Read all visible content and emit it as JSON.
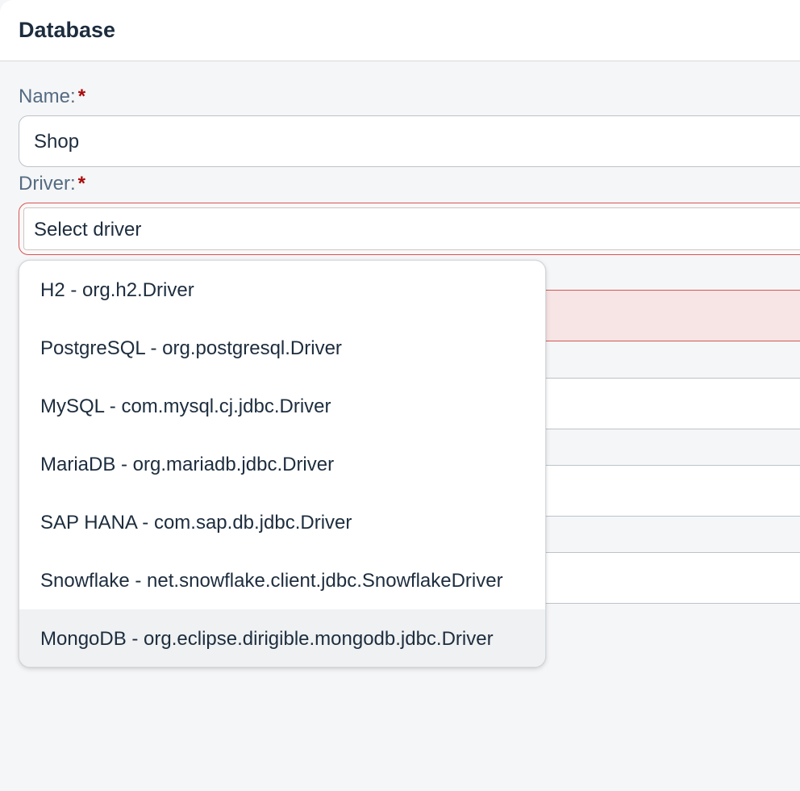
{
  "header": {
    "title": "Database"
  },
  "form": {
    "name": {
      "label": "Name:",
      "required": "*",
      "value": "Shop"
    },
    "driver": {
      "label": "Driver:",
      "required": "*",
      "value": "Select driver",
      "options": [
        "H2 - org.h2.Driver",
        "PostgreSQL - org.postgresql.Driver",
        "MySQL - com.mysql.cj.jdbc.Driver",
        "MariaDB - org.mariadb.jdbc.Driver",
        "SAP HANA - com.sap.db.jdbc.Driver",
        "Snowflake - net.snowflake.client.jdbc.SnowflakeDriver",
        "MongoDB - org.eclipse.dirigible.mongodb.jdbc.Driver"
      ],
      "hovered_option": "MongoDB - org.eclipse.dirigible.mongodb.jdbc.Driver"
    }
  },
  "colors": {
    "required_asterisk": "#aa0808",
    "error_border": "#d35656",
    "error_background": "#f7e4e4",
    "hover_background": "#eff1f2"
  }
}
